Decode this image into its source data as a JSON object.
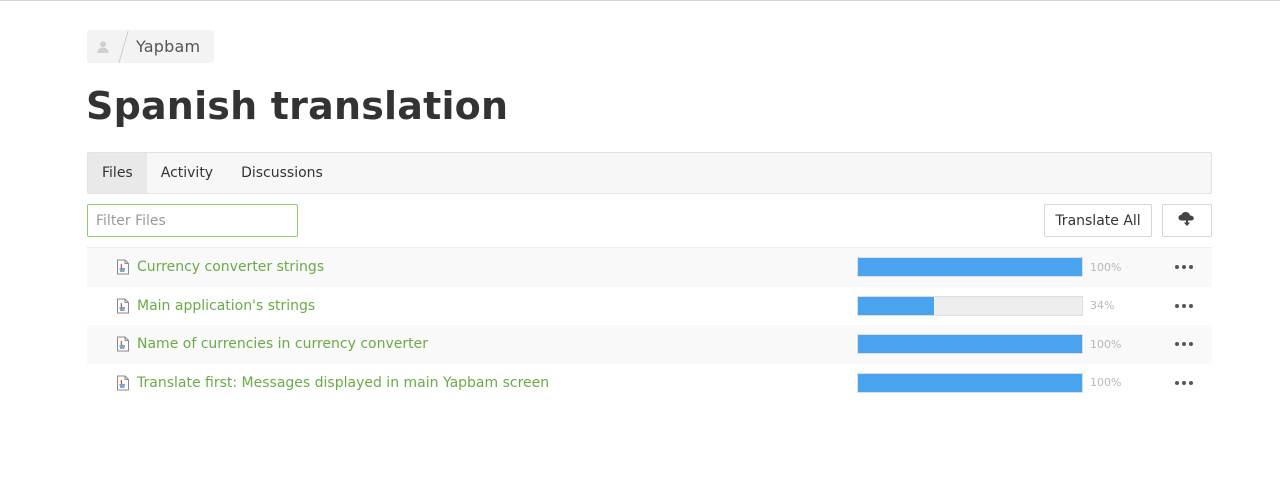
{
  "breadcrumb": {
    "project": "Yapbam",
    "avatar_icon": "user-avatar-icon"
  },
  "page": {
    "title": "Spanish translation"
  },
  "tabs": [
    {
      "label": "Files",
      "active": true
    },
    {
      "label": "Activity",
      "active": false
    },
    {
      "label": "Discussions",
      "active": false
    }
  ],
  "filter": {
    "placeholder": "Filter Files",
    "value": ""
  },
  "toolbar": {
    "translate_all_label": "Translate All",
    "download_icon": "cloud-download-icon"
  },
  "colors": {
    "accent_green": "#6aaa4a",
    "progress_blue": "#4aa3ee"
  },
  "files": [
    {
      "name": "Currency converter strings",
      "progress": 100,
      "progress_label": "100%"
    },
    {
      "name": "Main application's strings",
      "progress": 34,
      "progress_label": "34%"
    },
    {
      "name": "Name of currencies in currency converter",
      "progress": 100,
      "progress_label": "100%"
    },
    {
      "name": "Translate first: Messages displayed in main Yapbam screen",
      "progress": 100,
      "progress_label": "100%"
    }
  ]
}
